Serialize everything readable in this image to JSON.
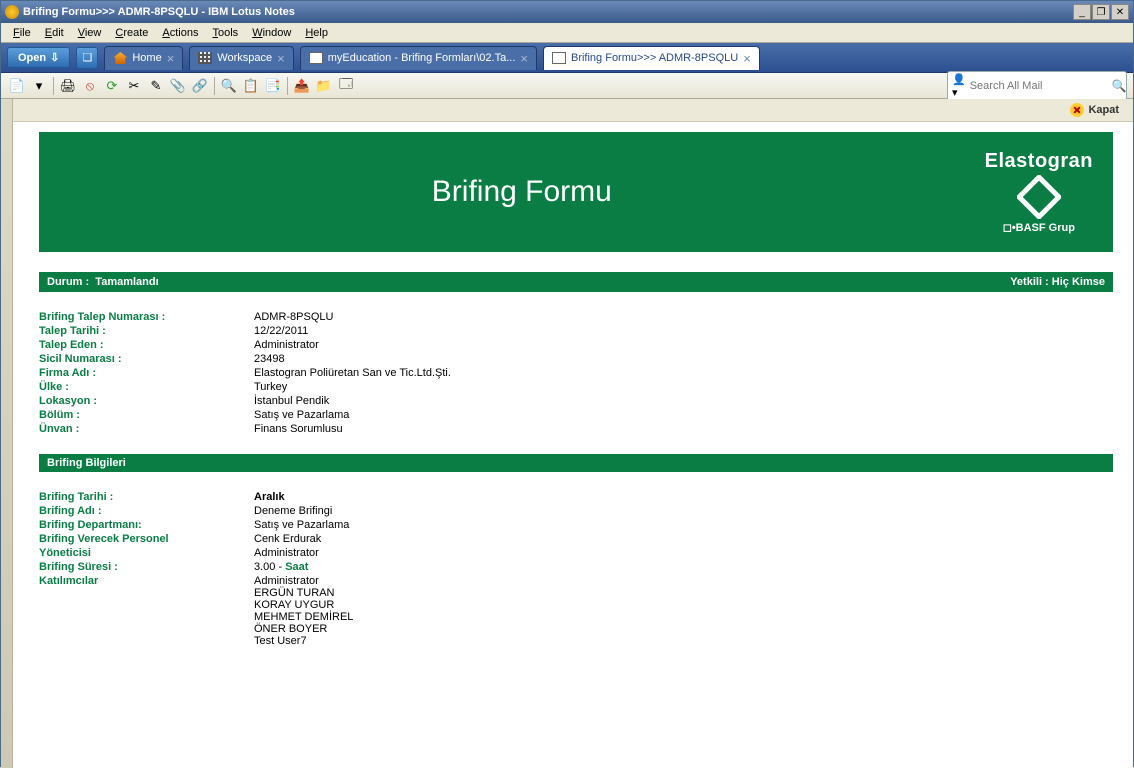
{
  "window": {
    "title": "Brifing Formu>>> ADMR-8PSQLU - IBM Lotus Notes"
  },
  "menubar": [
    "File",
    "Edit",
    "View",
    "Create",
    "Actions",
    "Tools",
    "Window",
    "Help"
  ],
  "open_label": "Open",
  "tabs": [
    {
      "label": "Home"
    },
    {
      "label": "Workspace"
    },
    {
      "label": "myEducation - Brifing Formları\\02.Ta..."
    },
    {
      "label": "Brifing Formu>>> ADMR-8PSQLU"
    }
  ],
  "search_placeholder": "Search All Mail",
  "kapat_label": "Kapat",
  "banner_title": "Brifing Formu",
  "brand_name": "Elastogran",
  "brand_sub": "◻•BASF Grup",
  "status": {
    "durum_label": "Durum :",
    "durum_value": "Tamamlandı",
    "yetkili_label": "Yetkili :",
    "yetkili_value": "Hiç Kimse"
  },
  "fields1": [
    {
      "label": "Brifing Talep Numarası :",
      "value": "ADMR-8PSQLU"
    },
    {
      "label": "Talep Tarihi :",
      "value": "12/22/2011"
    },
    {
      "label": "Talep Eden :",
      "value": "Administrator"
    },
    {
      "label": "Sicil Numarası :",
      "value": "23498"
    },
    {
      "label": "Firma Adı :",
      "value": "Elastogran Poliüretan San ve Tic.Ltd.Şti."
    },
    {
      "label": "Ülke :",
      "value": "Turkey"
    },
    {
      "label": "Lokasyon :",
      "value": "İstanbul Pendik"
    },
    {
      "label": "Bölüm :",
      "value": "Satış ve Pazarlama"
    },
    {
      "label": "Ünvan :",
      "value": "Finans Sorumlusu"
    }
  ],
  "section2_title": "Brifing Bilgileri",
  "fields2": [
    {
      "label": "Brifing Tarihi :",
      "value": "Aralık",
      "bold": true
    },
    {
      "label": "Brifing Adı :",
      "value": "Deneme Brifingi"
    },
    {
      "label": "Brifing Departmanı:",
      "value": "Satış ve Pazarlama"
    },
    {
      "label": "Brifing Verecek Personel",
      "value": "Cenk Erdurak"
    },
    {
      "label": "Yöneticisi",
      "value": "Administrator"
    }
  ],
  "duration": {
    "label": "Brifing Süresi :",
    "value": "3.00",
    "unit": "Saat"
  },
  "participants": {
    "label": "Katılımcılar",
    "list": [
      "Administrator",
      "ERGÜN TURAN",
      "KORAY UYGUR",
      "MEHMET DEMİREL",
      "ÖNER BOYER",
      "Test User7"
    ]
  }
}
